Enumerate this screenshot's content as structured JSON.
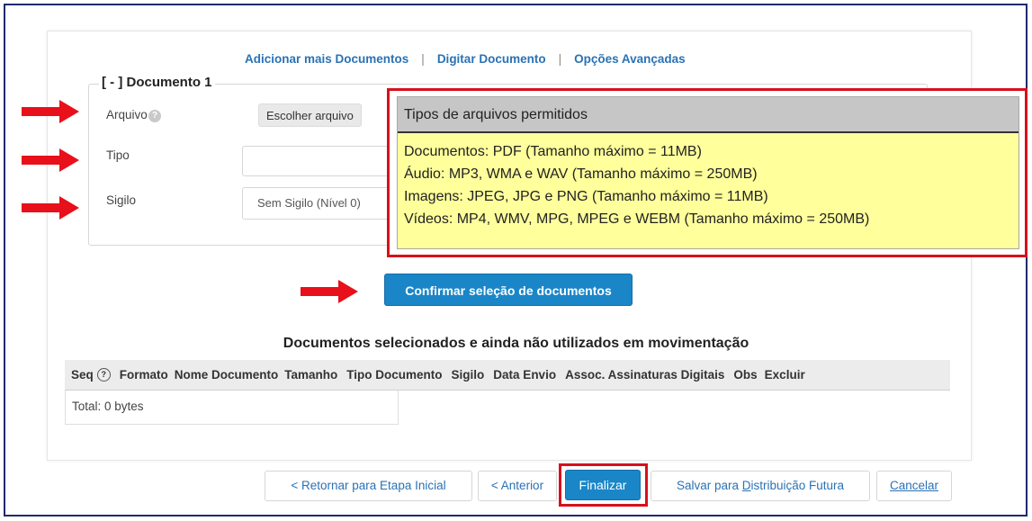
{
  "toplinks": {
    "add_more": "Adicionar mais Documentos",
    "separator": "|",
    "type_doc": "Digitar Documento",
    "advanced": "Opções Avançadas"
  },
  "document": {
    "legend": "[ - ] Documento 1",
    "file_label": "Arquivo",
    "choose_button": "Escolher arquivo",
    "type_label": "Tipo",
    "type_value": "",
    "secrecy_label": "Sigilo",
    "secrecy_value": "Sem Sigilo (Nível 0)"
  },
  "tooltip": {
    "title": "Tipos de arquivos permitidos",
    "lines": [
      "Documentos: PDF (Tamanho máximo = 11MB)",
      "Áudio: MP3, WMA e WAV (Tamanho máximo = 250MB)",
      "Imagens: JPEG, JPG e PNG (Tamanho máximo = 11MB)",
      "Vídeos: MP4, WMV, MPG, MPEG e WEBM (Tamanho máximo = 250MB)"
    ]
  },
  "confirm_button": "Confirmar seleção de documentos",
  "table": {
    "title": "Documentos selecionados e ainda não utilizados em movimentação",
    "columns": [
      "Seq",
      "Formato",
      "Nome Documento",
      "Tamanho",
      "Tipo Documento",
      "Sigilo",
      "Data Envio",
      "Assoc. Assinaturas Digitais",
      "Obs",
      "Excluir"
    ],
    "total": "Total: 0 bytes"
  },
  "footer": {
    "back_initial": "< Retornar para Etapa Inicial",
    "previous": "< Anterior",
    "finalize": "Finalizar",
    "save_prefix": "Salvar para ",
    "save_underlined": "D",
    "save_suffix": "istribuição Futura",
    "cancel_underlined": "C",
    "cancel_suffix": "ancelar"
  },
  "colors": {
    "accent_blue": "#1a86c7",
    "link_blue": "#2a72b5",
    "highlight_red": "#d6111c",
    "tooltip_yellow": "#ffff9c"
  }
}
